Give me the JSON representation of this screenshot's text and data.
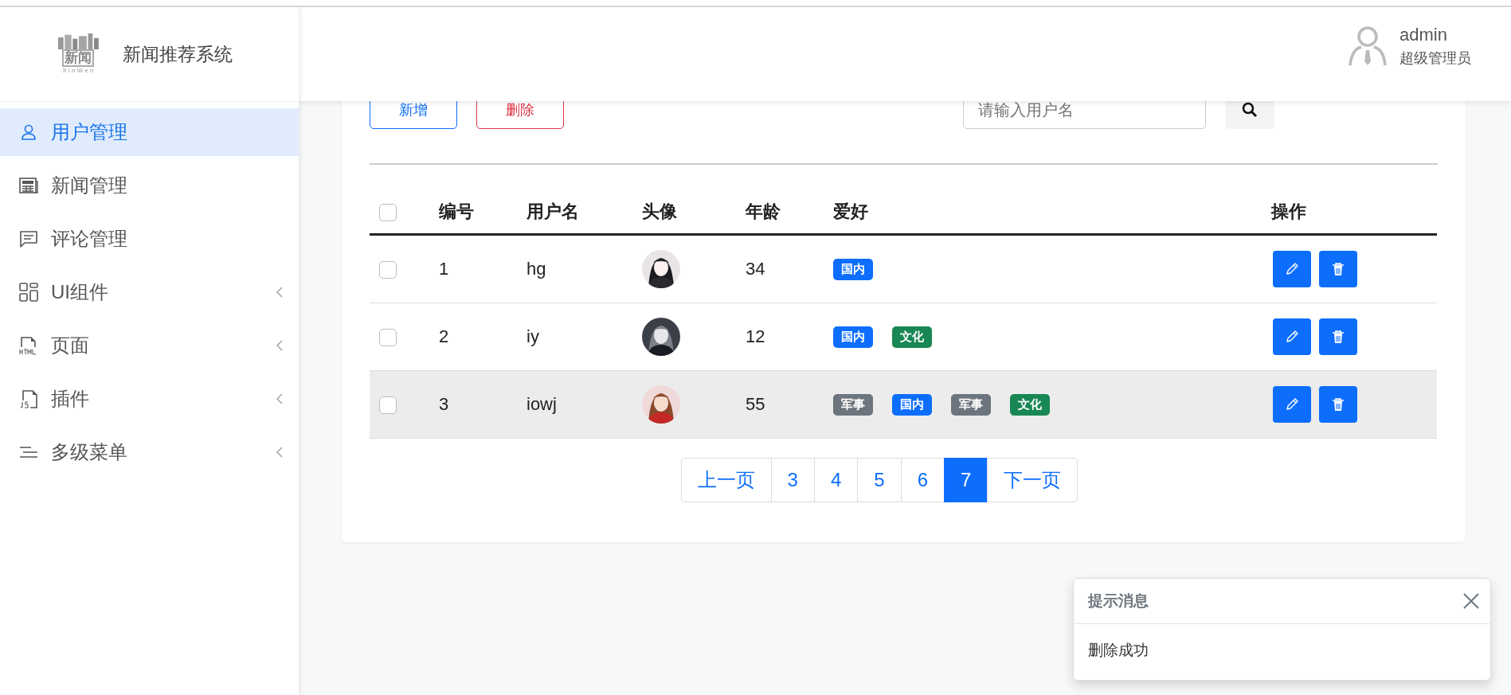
{
  "sidebar": {
    "logo": {
      "text": "新闻",
      "subtext": "X i n W e n"
    },
    "title": "新闻推荐系统",
    "items": [
      {
        "label": "用户管理",
        "selected": true,
        "expandable": false
      },
      {
        "label": "新闻管理",
        "selected": false,
        "expandable": false
      },
      {
        "label": "评论管理",
        "selected": false,
        "expandable": false
      },
      {
        "label": "UI组件",
        "selected": false,
        "expandable": true
      },
      {
        "label": "页面",
        "selected": false,
        "expandable": true
      },
      {
        "label": "插件",
        "selected": false,
        "expandable": true
      },
      {
        "label": "多级菜单",
        "selected": false,
        "expandable": true
      }
    ]
  },
  "header": {
    "user": {
      "name": "admin",
      "role": "超级管理员"
    }
  },
  "toolbar": {
    "buttons": [
      {
        "label": "新增",
        "kind": "primary"
      },
      {
        "label": "删除",
        "kind": "danger"
      }
    ],
    "search": {
      "placeholder": "请输入用户名"
    }
  },
  "table": {
    "select_all": {
      "checked": false
    },
    "columns": [
      "编号",
      "用户名",
      "头像",
      "年龄",
      "爱好",
      "操作"
    ],
    "rows": [
      {
        "checked": false,
        "hovered": false,
        "id": "1",
        "username": "hg",
        "avatar": {
          "kind": "picture"
        },
        "age": "34",
        "hobbies": [
          {
            "label": "国内",
            "color": "#0d6efd"
          }
        ]
      },
      {
        "checked": false,
        "hovered": false,
        "id": "2",
        "username": "iy",
        "avatar": {
          "kind": "picture"
        },
        "age": "12",
        "hobbies": [
          {
            "label": "国内",
            "color": "#0d6efd"
          },
          {
            "label": "文化",
            "color": "#198754"
          }
        ]
      },
      {
        "checked": false,
        "hovered": true,
        "id": "3",
        "username": "iowj",
        "avatar": {
          "kind": "picture"
        },
        "age": "55",
        "hobbies": [
          {
            "label": "军事",
            "color": "#6c757d"
          },
          {
            "label": "国内",
            "color": "#0d6efd"
          },
          {
            "label": "军事",
            "color": "#6c757d"
          },
          {
            "label": "文化",
            "color": "#198754"
          }
        ]
      }
    ]
  },
  "pagination": {
    "previous": "上一页",
    "pages": [
      {
        "label": "3",
        "selected": false
      },
      {
        "label": "4",
        "selected": false
      },
      {
        "label": "5",
        "selected": false
      },
      {
        "label": "6",
        "selected": false
      },
      {
        "label": "7",
        "selected": true
      }
    ],
    "next": "下一页"
  },
  "toast": {
    "title": "提示消息",
    "message": "删除成功"
  }
}
